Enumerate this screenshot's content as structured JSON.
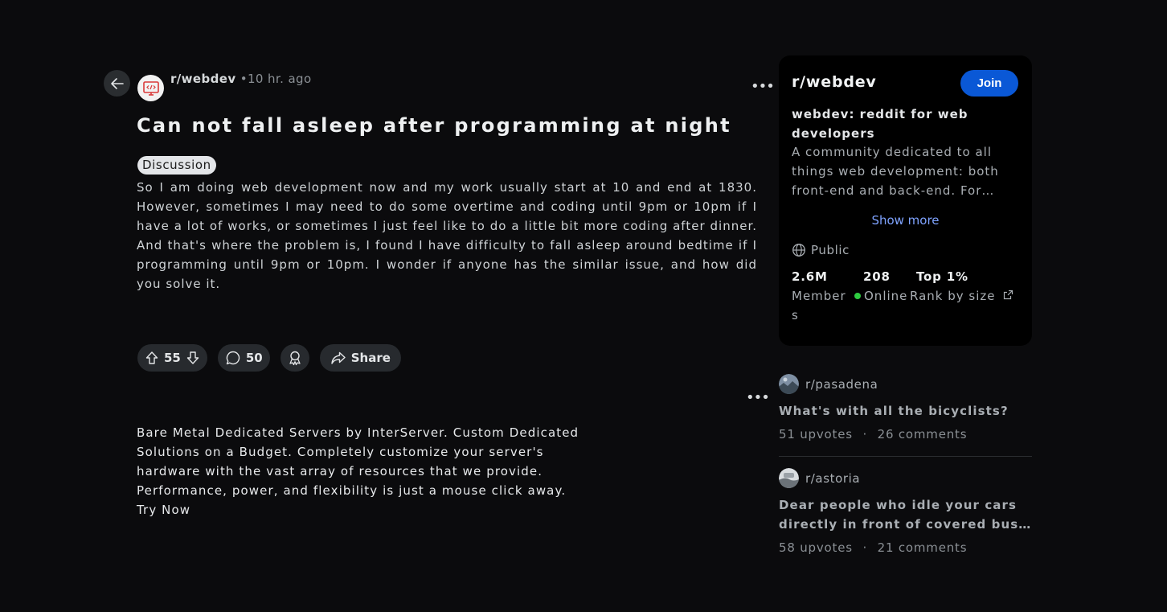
{
  "post": {
    "subreddit": "r/webdev",
    "separator": "•",
    "time": "10 hr. ago",
    "title": "Can not fall asleep after programming at night",
    "flair": "Discussion",
    "body": "So I am doing web development now and my work usually start at 10 and end at 1830. However, sometimes I may need to do some overtime and coding until 9pm or 10pm if I have a lot of works, or sometimes I just feel like to do a little bit more coding after dinner. And that's where the problem is, I found I have difficulty to fall asleep around bedtime if I programming until 9pm or 10pm. I wonder if anyone has the similar issue, and how did you solve it.",
    "votes": "55",
    "comments": "50",
    "share_label": "Share"
  },
  "ad": {
    "text": "Bare Metal Dedicated Servers by InterServer. Custom Dedicated Solutions on a Budget. Completely customize your server's hardware with the vast array of resources that we provide. Performance, power, and flexibility is just a mouse click away.",
    "cta": "Try Now"
  },
  "sidebar": {
    "name": "r/webdev",
    "join_label": "Join",
    "subtitle": "webdev: reddit for web developers",
    "description": "A community dedicated to all things web development: both front-end and back-end. For…",
    "show_more": "Show more",
    "visibility": "Public",
    "stats": {
      "members_value": "2.6M",
      "members_label": "Member",
      "members_label_wrap": "s",
      "online_value": "208",
      "online_label": "Online",
      "rank_value": "Top 1%",
      "rank_label": "Rank by size"
    },
    "online_color": "#2ecc40",
    "join_color": "#0a58d6"
  },
  "related": [
    {
      "subreddit": "r/pasadena",
      "title": "What's with all the bicyclists?",
      "upvotes": "51 upvotes",
      "sep": "·",
      "comments": "26 comments"
    },
    {
      "subreddit": "r/astoria",
      "title": "Dear people who idle your cars directly in front of covered bus…",
      "upvotes": "58 upvotes",
      "sep": "·",
      "comments": "21 comments"
    }
  ],
  "icons": {
    "back": "arrow-left-icon",
    "more": "more-horizontal-icon",
    "upvote": "arrow-up-icon",
    "downvote": "arrow-down-icon",
    "comment": "comment-bubble-icon",
    "award": "award-ribbon-icon",
    "share": "share-arrow-icon",
    "globe": "globe-icon",
    "external": "external-link-icon"
  },
  "more_glyph": "•••"
}
